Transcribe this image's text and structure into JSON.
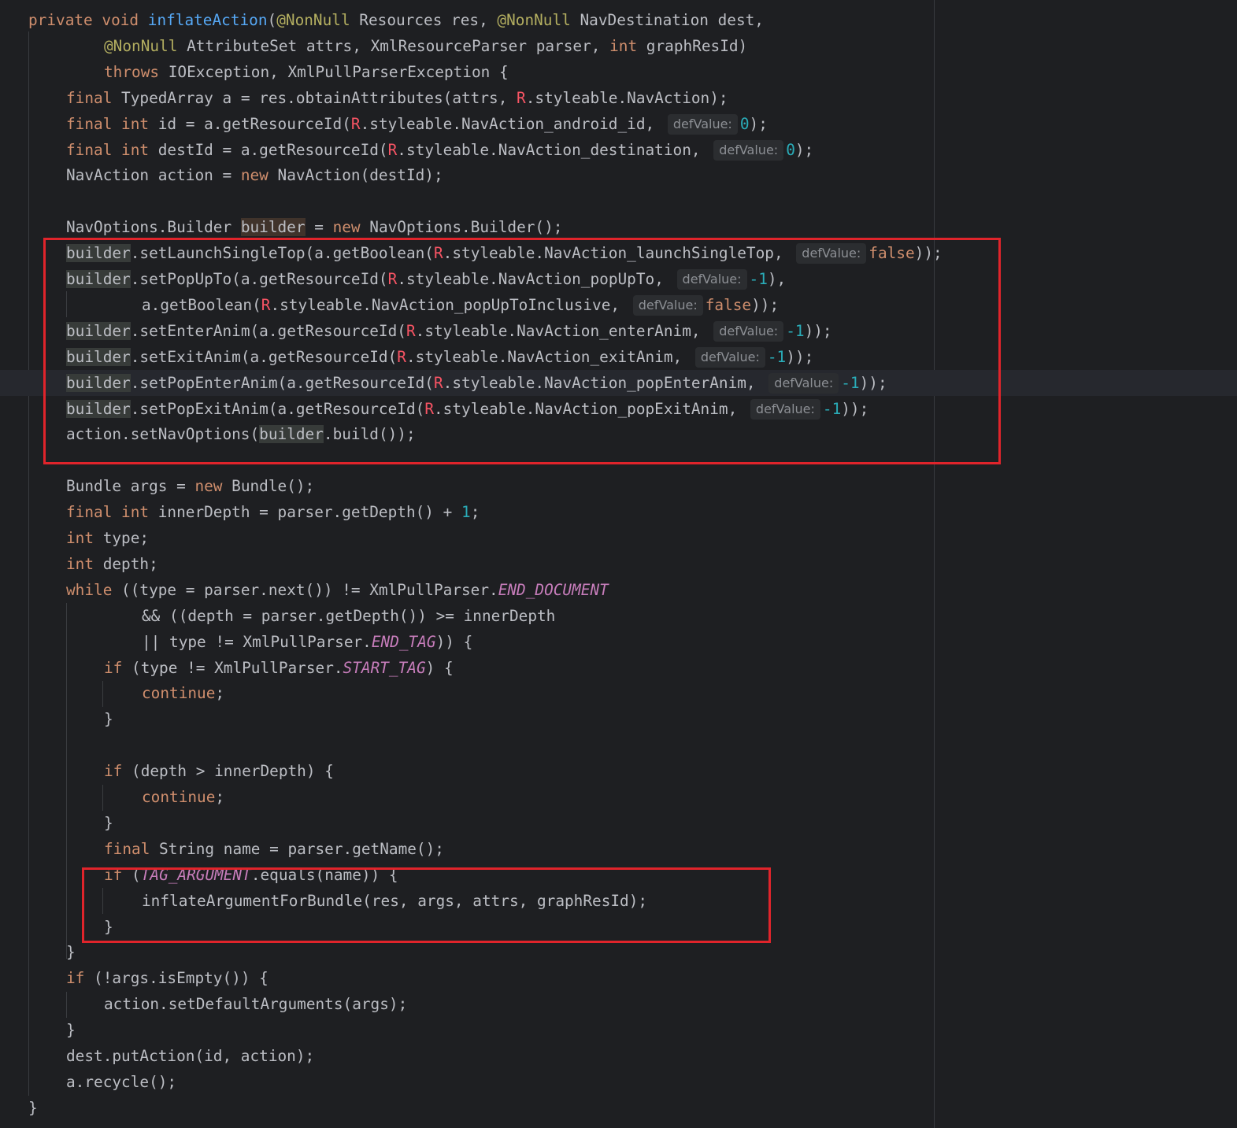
{
  "editor": {
    "lines": [
      [
        [
          "kw",
          "private void "
        ],
        [
          "fn",
          "inflateAction"
        ],
        [
          "",
          "("
        ],
        [
          "ann",
          "@NonNull"
        ],
        [
          "",
          " Resources res, "
        ],
        [
          "ann",
          "@NonNull"
        ],
        [
          "",
          " NavDestination dest,"
        ]
      ],
      [
        [
          "ann",
          "@NonNull"
        ],
        [
          "",
          " AttributeSet attrs, XmlResourceParser parser, "
        ],
        [
          "kw",
          "int"
        ],
        [
          "",
          " graphResId)"
        ]
      ],
      [
        [
          "kw",
          "throws"
        ],
        [
          "",
          " IOException, XmlPullParserException {"
        ]
      ],
      [
        [
          "kw",
          "final"
        ],
        [
          "",
          " TypedArray a = res.obtainAttributes(attrs, "
        ],
        [
          "r",
          "R"
        ],
        [
          "",
          ".styleable.NavAction);"
        ]
      ],
      [
        [
          "kw",
          "final int"
        ],
        [
          "",
          " id = a.getResourceId("
        ],
        [
          "r",
          "R"
        ],
        [
          "",
          ".styleable.NavAction_android_id, "
        ],
        [
          "hint",
          "defValue:"
        ],
        [
          "num",
          "0"
        ],
        [
          "",
          ");"
        ]
      ],
      [
        [
          "kw",
          "final int"
        ],
        [
          "",
          " destId = a.getResourceId("
        ],
        [
          "r",
          "R"
        ],
        [
          "",
          ".styleable.NavAction_destination, "
        ],
        [
          "hint",
          "defValue:"
        ],
        [
          "num",
          "0"
        ],
        [
          "",
          ");"
        ]
      ],
      [
        [
          "",
          "NavAction action = "
        ],
        [
          "kw",
          "new"
        ],
        [
          "",
          " NavAction(destId);"
        ]
      ],
      [],
      [
        [
          "",
          "NavOptions.Builder "
        ],
        [
          "hl-write",
          "builder"
        ],
        [
          "",
          " = "
        ],
        [
          "kw",
          "new"
        ],
        [
          "",
          " NavOptions.Builder();"
        ]
      ],
      [
        [
          "hl",
          "builder"
        ],
        [
          "",
          ".setLaunchSingleTop(a.getBoolean("
        ],
        [
          "r",
          "R"
        ],
        [
          "",
          ".styleable.NavAction_launchSingleTop, "
        ],
        [
          "hint",
          "defValue:"
        ],
        [
          "kw",
          "false"
        ],
        [
          "",
          "));"
        ]
      ],
      [
        [
          "hl",
          "builder"
        ],
        [
          "",
          ".setPopUpTo(a.getResourceId("
        ],
        [
          "r",
          "R"
        ],
        [
          "",
          ".styleable.NavAction_popUpTo, "
        ],
        [
          "hint",
          "defValue:"
        ],
        [
          "num",
          "-1"
        ],
        [
          "",
          "),"
        ]
      ],
      [
        [
          "",
          "a.getBoolean("
        ],
        [
          "r",
          "R"
        ],
        [
          "",
          ".styleable.NavAction_popUpToInclusive, "
        ],
        [
          "hint",
          "defValue:"
        ],
        [
          "kw",
          "false"
        ],
        [
          "",
          "));"
        ]
      ],
      [
        [
          "hl",
          "builder"
        ],
        [
          "",
          ".setEnterAnim(a.getResourceId("
        ],
        [
          "r",
          "R"
        ],
        [
          "",
          ".styleable.NavAction_enterAnim, "
        ],
        [
          "hint",
          "defValue:"
        ],
        [
          "num",
          "-1"
        ],
        [
          "",
          "));"
        ]
      ],
      [
        [
          "hl",
          "builder"
        ],
        [
          "",
          ".setExitAnim(a.getResourceId("
        ],
        [
          "r",
          "R"
        ],
        [
          "",
          ".styleable.NavAction_exitAnim, "
        ],
        [
          "hint",
          "defValue:"
        ],
        [
          "num",
          "-1"
        ],
        [
          "",
          "));"
        ]
      ],
      [
        [
          "hl",
          "builder"
        ],
        [
          "",
          ".setPopEnterAnim(a.getResourceId("
        ],
        [
          "r",
          "R"
        ],
        [
          "",
          ".styleable.NavAction_popEnterAnim, "
        ],
        [
          "hint",
          "defValue:"
        ],
        [
          "num",
          "-1"
        ],
        [
          "",
          "));"
        ]
      ],
      [
        [
          "hl",
          "builder"
        ],
        [
          "",
          ".setPopExitAnim(a.getResourceId("
        ],
        [
          "r",
          "R"
        ],
        [
          "",
          ".styleable.NavAction_popExitAnim, "
        ],
        [
          "hint",
          "defValue:"
        ],
        [
          "num",
          "-1"
        ],
        [
          "",
          "));"
        ]
      ],
      [
        [
          "",
          "action.setNavOptions("
        ],
        [
          "hl",
          "builder"
        ],
        [
          "",
          ".build());"
        ]
      ],
      [],
      [
        [
          "",
          "Bundle args = "
        ],
        [
          "kw",
          "new"
        ],
        [
          "",
          " Bundle();"
        ]
      ],
      [
        [
          "kw",
          "final int"
        ],
        [
          "",
          " innerDepth = parser.getDepth() + "
        ],
        [
          "num",
          "1"
        ],
        [
          "",
          ";"
        ]
      ],
      [
        [
          "kw",
          "int"
        ],
        [
          "",
          " type;"
        ]
      ],
      [
        [
          "kw",
          "int"
        ],
        [
          "",
          " depth;"
        ]
      ],
      [
        [
          "kw",
          "while"
        ],
        [
          "",
          " ((type = parser.next()) != XmlPullParser."
        ],
        [
          "const",
          "END_DOCUMENT"
        ]
      ],
      [
        [
          "",
          "&& ((depth = parser.getDepth()) >= innerDepth"
        ]
      ],
      [
        [
          "",
          "|| type != XmlPullParser."
        ],
        [
          "const",
          "END_TAG"
        ],
        [
          "",
          "))"
        ],
        [
          "",
          " {"
        ]
      ],
      [
        [
          "kw",
          "if"
        ],
        [
          "",
          " (type != XmlPullParser."
        ],
        [
          "const",
          "START_TAG"
        ],
        [
          "",
          ") {"
        ]
      ],
      [
        [
          "kw",
          "continue"
        ],
        [
          "",
          ";"
        ]
      ],
      [
        [
          "",
          "}"
        ]
      ],
      [],
      [
        [
          "kw",
          "if"
        ],
        [
          "",
          " (depth > innerDepth) {"
        ]
      ],
      [
        [
          "kw",
          "continue"
        ],
        [
          "",
          ";"
        ]
      ],
      [
        [
          "",
          "}"
        ]
      ],
      [
        [
          "kw",
          "final"
        ],
        [
          "",
          " String name = parser.getName();"
        ]
      ],
      [
        [
          "kw",
          "if"
        ],
        [
          "",
          " ("
        ],
        [
          "const",
          "TAG_ARGUMENT"
        ],
        [
          "",
          ".equals(name)) {"
        ]
      ],
      [
        [
          "",
          "inflateArgumentForBundle(res, args, attrs, graphResId);"
        ]
      ],
      [
        [
          "",
          "}"
        ]
      ],
      [
        [
          "",
          "}"
        ]
      ],
      [
        [
          "kw",
          "if"
        ],
        [
          "",
          " (!args.isEmpty()) {"
        ]
      ],
      [
        [
          "",
          "action.setDefaultArguments(args);"
        ]
      ],
      [
        [
          "",
          "}"
        ]
      ],
      [
        [
          "",
          "dest.putAction(id, action);"
        ]
      ],
      [
        [
          "",
          "a.recycle();"
        ]
      ],
      [
        [
          "",
          "}"
        ]
      ]
    ]
  },
  "colors": {
    "background": "#1e1f22",
    "keyword": "#cf8e6d",
    "function": "#56a8f5",
    "annotation": "#b3ae60",
    "number": "#2aacb8",
    "r_class": "#f75464",
    "constant": "#c77dbb",
    "highlight_box": "#e0242b"
  }
}
